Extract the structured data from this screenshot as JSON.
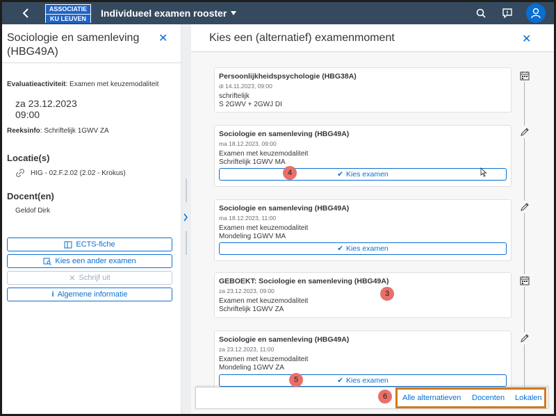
{
  "shell": {
    "logo_line1": "ASSOCIATIE",
    "logo_line2": "KU LEUVEN",
    "app_title": "Individueel examen rooster"
  },
  "detail": {
    "title": "Sociologie en samenleving (HBG49A)",
    "evaluatie_label": "Evaluatieactiviteit",
    "evaluatie_value": ": Examen met keuzemodaliteit",
    "date": "za 23.12.2023",
    "time": "09:00",
    "reeks_label": "Reeksinfo",
    "reeks_value": ": Schriftelijk 1GWV ZA",
    "locatie_header": "Locatie(s)",
    "locatie_value": "HIG - 02.F.2.02 (2.02 - Krokus)",
    "docent_header": "Docent(en)",
    "docent_value": "Geldof Dirk",
    "buttons": {
      "ects": "ECTS-fiche",
      "ander": "Kies een ander examen",
      "schrijf": "Schrijf uit",
      "info": "Algemene informatie"
    }
  },
  "panel": {
    "title": "Kies een (alternatief) examenmoment",
    "cards": [
      {
        "title": "Persoonlijkheidspsychologie (HBG38A)",
        "date": "di 14.11.2023, 09:00",
        "line1": "schriftelijk",
        "line2": "S 2GWV + 2GWJ DI",
        "button": ""
      },
      {
        "title": "Sociologie en samenleving (HBG49A)",
        "date": "ma 18.12.2023, 09:00",
        "line1": "Examen met keuzemodaliteit",
        "line2": "Schriftelijk 1GWV MA",
        "button": "Kies examen"
      },
      {
        "title": "Sociologie en samenleving (HBG49A)",
        "date": "ma 18.12.2023, 11:00",
        "line1": "Examen met keuzemodaliteit",
        "line2": "Mondeling 1GWV MA",
        "button": "Kies examen"
      },
      {
        "title": "GEBOEKT: Sociologie en samenleving (HBG49A)",
        "date": "za 23.12.2023, 09:00",
        "line1": "Examen met keuzemodaliteit",
        "line2": "Schriftelijk 1GWV ZA",
        "button": ""
      },
      {
        "title": "Sociologie en samenleving (HBG49A)",
        "date": "za 23.12.2023, 11:00",
        "line1": "Examen met keuzemodaliteit",
        "line2": "Mondeling 1GWV ZA",
        "button": "Kies examen"
      }
    ]
  },
  "footer": {
    "alle": "Alle alternatieven",
    "docenten": "Docenten",
    "lokalen": "Lokalen"
  },
  "markers": {
    "m3": "3",
    "m4": "4",
    "m5": "5",
    "m6": "6"
  },
  "icons": {
    "back": "chevron-left-icon",
    "dropdown": "triangle-down-icon",
    "search": "search-icon",
    "feedback": "feedback-icon",
    "user": "person-icon",
    "calendar": "calendar-icon",
    "edit": "pencil-icon"
  },
  "colors": {
    "shellbar": "#354a5f",
    "accent": "#0a6ed1",
    "marker": "#e8706a",
    "highlight_box": "#d07a1e"
  }
}
